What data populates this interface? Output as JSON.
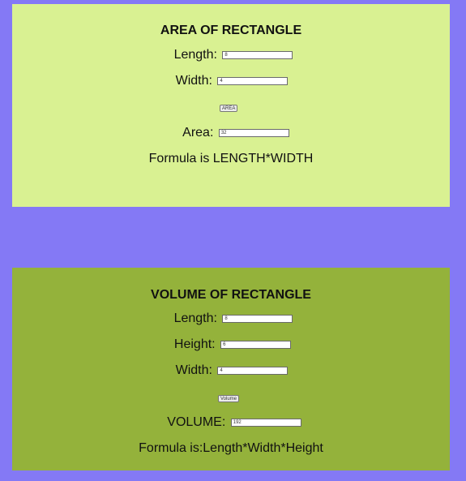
{
  "area": {
    "title": "AREA OF RECTANGLE",
    "length_label": "Length:",
    "length_value": "8",
    "width_label": "Width:",
    "width_value": "4",
    "button_label": "AREA",
    "result_label": "Area:",
    "result_value": "32",
    "formula": "Formula is LENGTH*WIDTH"
  },
  "volume": {
    "title": "VOLUME OF RECTANGLE",
    "length_label": "Length:",
    "length_value": "8",
    "height_label": "Height:",
    "height_value": "6",
    "width_label": "Width:",
    "width_value": "4",
    "button_label": "Volume",
    "result_label": "VOLUME:",
    "result_value": "192",
    "formula": "Formula is:Length*Width*Height"
  },
  "colors": {
    "page_background": "#8479f5",
    "area_panel": "#d9f192",
    "volume_panel": "#94b23b"
  }
}
